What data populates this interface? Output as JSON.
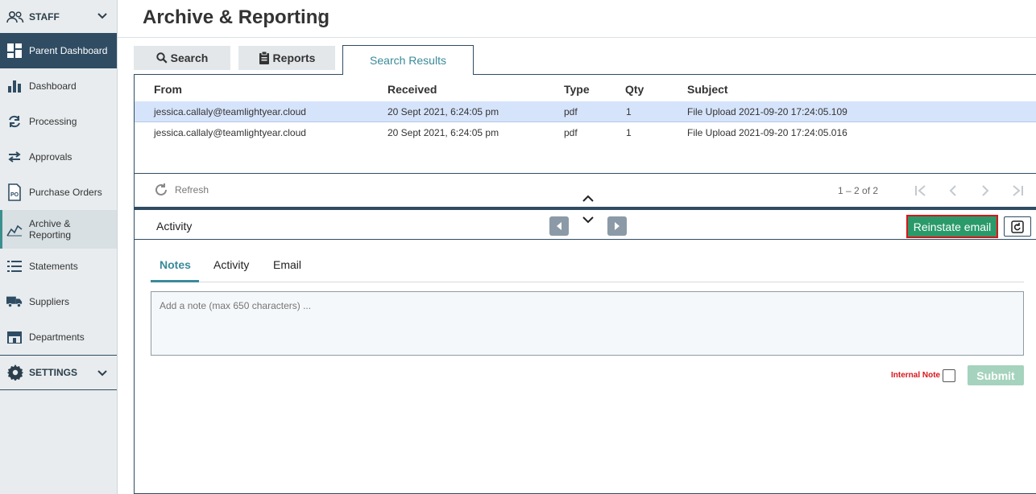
{
  "sidebar": {
    "staff_label": "STAFF",
    "active_label": "Parent Dashboard",
    "items": [
      {
        "label": "Dashboard",
        "icon": "bar-chart-icon"
      },
      {
        "label": "Processing",
        "icon": "sync-icon"
      },
      {
        "label": "Approvals",
        "icon": "swap-arrows-icon"
      },
      {
        "label": "Purchase Orders",
        "icon": "po-document-icon"
      },
      {
        "label_line1": "Archive &",
        "label_line2": "Reporting",
        "icon": "line-chart-icon"
      },
      {
        "label": "Statements",
        "icon": "list-icon"
      },
      {
        "label": "Suppliers",
        "icon": "truck-icon"
      },
      {
        "label": "Departments",
        "icon": "building-icon"
      }
    ],
    "settings_label": "SETTINGS"
  },
  "header": {
    "title": "Archive & Reporting"
  },
  "tabs": {
    "search": "Search",
    "reports": "Reports",
    "results": "Search Results"
  },
  "table": {
    "columns": [
      "From",
      "Received",
      "Type",
      "Qty",
      "Subject"
    ],
    "rows": [
      {
        "from": "jessica.callaly@teamlightyear.cloud",
        "received": "20 Sept 2021, 6:24:05 pm",
        "type": "pdf",
        "qty": "1",
        "subject": "File Upload 2021-09-20 17:24:05.109"
      },
      {
        "from": "jessica.callaly@teamlightyear.cloud",
        "received": "20 Sept 2021, 6:24:05 pm",
        "type": "pdf",
        "qty": "1",
        "subject": "File Upload 2021-09-20 17:24:05.016"
      }
    ]
  },
  "pager": {
    "refresh": "Refresh",
    "range": "1 – 2 of 2"
  },
  "activity": {
    "label": "Activity",
    "reinstate": "Reinstate email",
    "tabs": [
      "Notes",
      "Activity",
      "Email"
    ],
    "note_placeholder": "Add a note (max 650 characters) ...",
    "internal_note": "Internal Note",
    "submit": "Submit"
  },
  "colors": {
    "navy": "#2f4c63",
    "teal": "#3a8a9a",
    "green": "#2a9a6a",
    "highlight": "#d9151b"
  }
}
